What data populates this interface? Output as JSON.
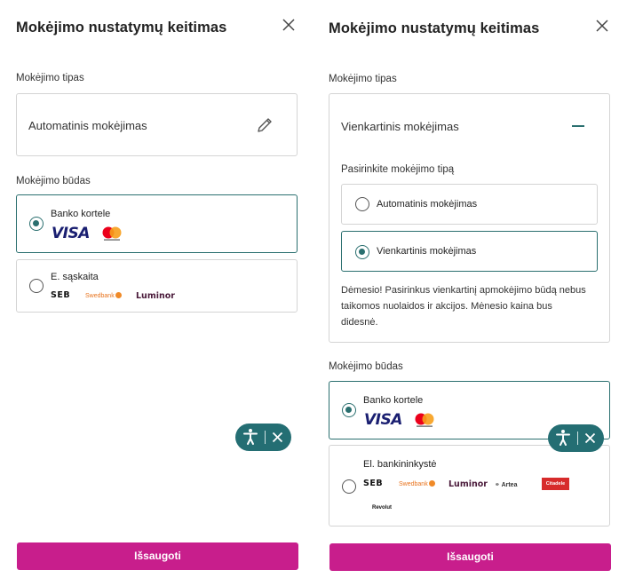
{
  "left": {
    "title": "Mokėjimo nustatymų keitimas",
    "type_label": "Mokėjimo tipas",
    "type_value": "Automatinis mokėjimas",
    "method_label": "Mokėjimo būdas",
    "options": [
      {
        "label": "Banko kortele",
        "selected": true
      },
      {
        "label": "E. sąskaita",
        "selected": false
      }
    ],
    "save_label": "Išsaugoti"
  },
  "right": {
    "title": "Mokėjimo nustatymų keitimas",
    "type_label": "Mokėjimo tipas",
    "type_value": "Vienkartinis mokėjimas",
    "choose_label": "Pasirinkite mokėjimo tipą",
    "type_options": [
      {
        "label": "Automatinis mokėjimas",
        "selected": false
      },
      {
        "label": "Vienkartinis mokėjimas",
        "selected": true
      }
    ],
    "warning_lines": [
      "Dėmesio! Pasirinkus vienkartinį apmokėjimo būdą nebus",
      "taikomos nuolaidos ir akcijos. Mėnesio kaina bus",
      "didesnė."
    ],
    "method_label": "Mokėjimo būdas",
    "options": [
      {
        "label": "Banko kortele",
        "selected": true
      },
      {
        "label": "El. bankininkystė",
        "selected": false
      }
    ],
    "save_label": "Išsaugoti"
  },
  "logos": {
    "visa": "VISA",
    "seb": "SEB",
    "swedbank": "Swedbank",
    "luminor": "Luminor",
    "artea": "Artea",
    "citadele": "Citadele",
    "revolut": "Revolut"
  },
  "colors": {
    "accent": "#2a6f6f",
    "save_button": "#c81e8c",
    "a11y_widget": "#246e73"
  },
  "icons": [
    "close-icon",
    "edit-icon",
    "minus-icon",
    "accessibility-icon"
  ]
}
